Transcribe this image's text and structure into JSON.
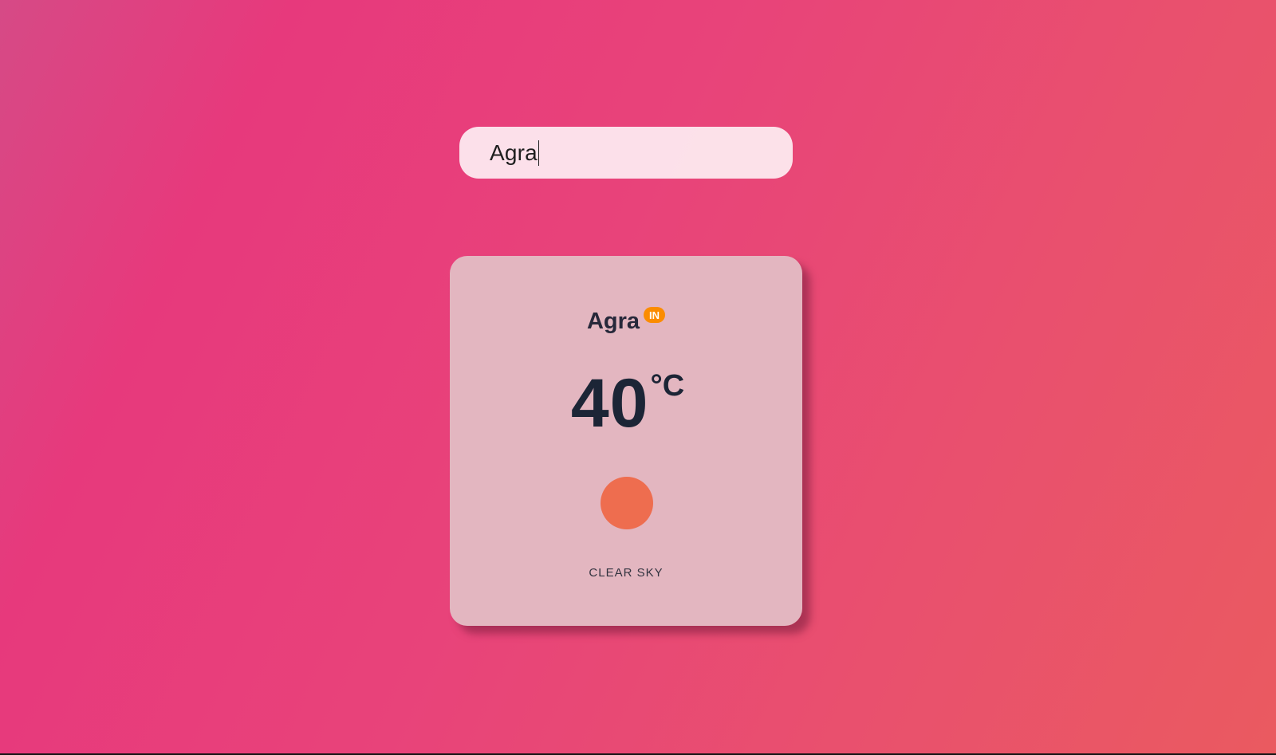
{
  "search": {
    "value": "Agra",
    "placeholder": ""
  },
  "weather": {
    "city": "Agra",
    "country_code": "IN",
    "temperature": "40",
    "unit": "°C",
    "condition": "CLEAR SKY",
    "icon": "sun-icon"
  },
  "colors": {
    "background_start": "#e7397c",
    "background_end": "#ea5a60",
    "badge": "#fb8c00",
    "sun": "#ee6d4f",
    "text_dark": "#1c2536"
  }
}
